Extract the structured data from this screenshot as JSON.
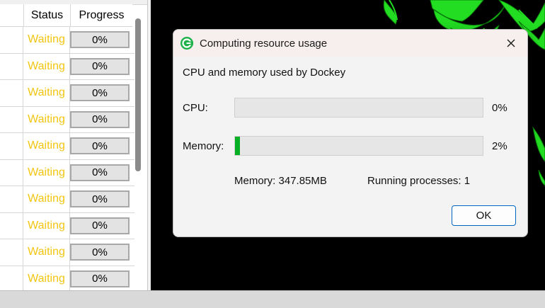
{
  "table": {
    "headers": {
      "status": "Status",
      "progress": "Progress"
    },
    "rows": [
      {
        "status": "Waiting",
        "progress": "0%"
      },
      {
        "status": "Waiting",
        "progress": "0%"
      },
      {
        "status": "Waiting",
        "progress": "0%"
      },
      {
        "status": "Waiting",
        "progress": "0%"
      },
      {
        "status": "Waiting",
        "progress": "0%"
      },
      {
        "status": "Waiting",
        "progress": "0%"
      },
      {
        "status": "Waiting",
        "progress": "0%"
      },
      {
        "status": "Waiting",
        "progress": "0%"
      },
      {
        "status": "Waiting",
        "progress": "0%"
      },
      {
        "status": "Waiting",
        "progress": "0%"
      }
    ],
    "status_color": "#f2c511"
  },
  "dialog": {
    "title": "Computing resource usage",
    "caption": "CPU and memory used by Dockey",
    "cpu_label": "CPU:",
    "cpu_value": "0%",
    "cpu_level": 0,
    "memory_label": "Memory:",
    "memory_value": "2%",
    "memory_level": 0.02,
    "memory_text": "Memory: 347.85MB",
    "processes_text": "Running processes: 1",
    "ok_label": "OK",
    "progress_color": "#06b025",
    "accent_color": "#0067c0"
  },
  "icons": {
    "app": "dockey-logo-icon",
    "close": "close-icon"
  }
}
